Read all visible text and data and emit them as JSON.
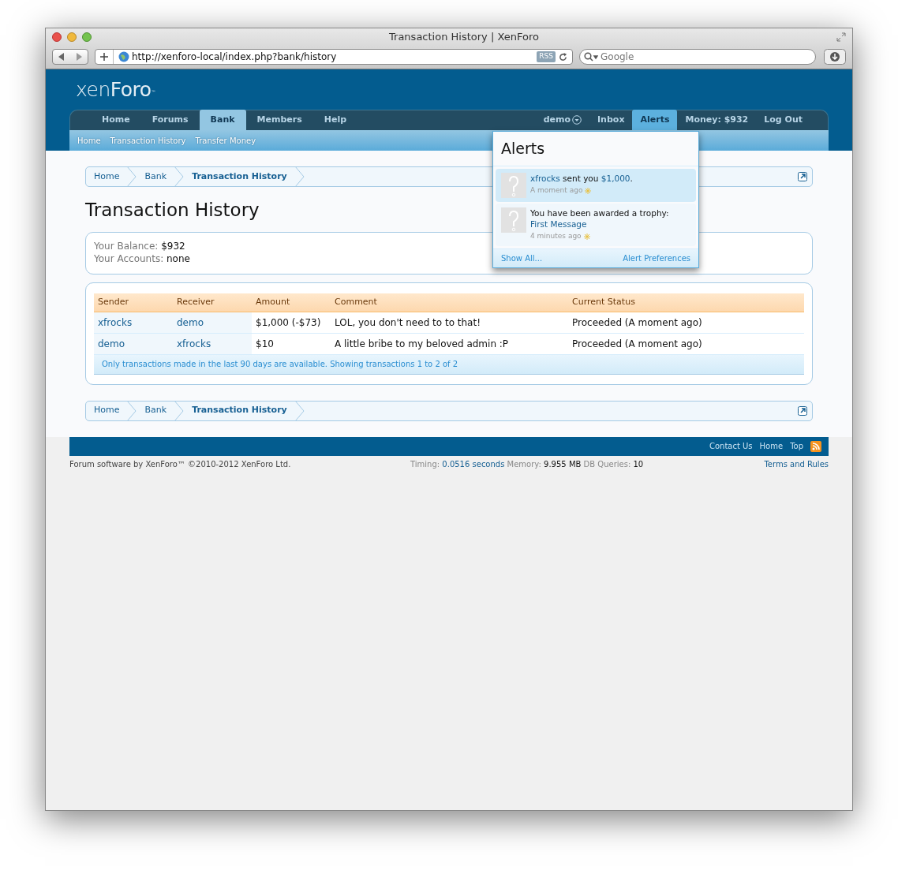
{
  "window": {
    "title": "Transaction History | XenForo"
  },
  "toolbar": {
    "url": "http://xenforo-local/index.php?bank/history",
    "rss": "RSS",
    "search_placeholder": "Google"
  },
  "logo": {
    "light": "xen",
    "bold": "Foro",
    "mark": "™"
  },
  "nav": {
    "tabs": [
      {
        "label": "Home",
        "selected": false
      },
      {
        "label": "Forums",
        "selected": false
      },
      {
        "label": "Bank",
        "selected": true
      },
      {
        "label": "Members",
        "selected": false
      },
      {
        "label": "Help",
        "selected": false
      }
    ],
    "user_links": [
      {
        "label": "demo",
        "kind": "menu",
        "selected": false
      },
      {
        "label": "Inbox",
        "kind": "link",
        "selected": false
      },
      {
        "label": "Alerts",
        "kind": "link",
        "selected": true
      },
      {
        "label": "Money: $932",
        "kind": "link",
        "selected": false
      },
      {
        "label": "Log Out",
        "kind": "link",
        "selected": false
      }
    ]
  },
  "subnav": [
    "Home",
    "Transaction History",
    "Transfer Money"
  ],
  "breadcrumbs_top": [
    "Home",
    "Bank",
    "Transaction History"
  ],
  "page_title": "Transaction History",
  "summary": [
    {
      "label": "Your Balance:",
      "value": "$932"
    },
    {
      "label": "Your Accounts:",
      "value": "none"
    }
  ],
  "table": {
    "columns": [
      "Sender",
      "Receiver",
      "Amount",
      "Comment",
      "Current Status"
    ],
    "rows": [
      {
        "sender": "xfrocks",
        "receiver": "demo",
        "amount": "$1,000 (-$73)",
        "comment": "LOL, you don't need to to that!",
        "status": "Proceeded (A moment ago)"
      },
      {
        "sender": "demo",
        "receiver": "xfrocks",
        "amount": "$10",
        "comment": "A little bribe to my beloved admin :P",
        "status": "Proceeded (A moment ago)"
      }
    ],
    "note": "Only transactions made in the last 90 days are available. Showing transactions 1 to 2 of 2"
  },
  "breadcrumbs_bottom": [
    "Home",
    "Bank",
    "Transaction History"
  ],
  "footer": {
    "links": [
      "Contact Us",
      "Home",
      "Top"
    ],
    "copyright": "Forum software by XenForo™ ©2010-2012 XenForo Ltd.",
    "debug": [
      {
        "label": "Timing:",
        "value": "0.0516 seconds",
        "kind": "link"
      },
      {
        "label": "Memory:",
        "value": "9.955 MB",
        "kind": "text"
      },
      {
        "label": "DB Queries:",
        "value": "10",
        "kind": "text"
      }
    ],
    "terms": "Terms and Rules"
  },
  "alerts_popup": {
    "title": "Alerts",
    "items": [
      {
        "unread": true,
        "parts": [
          {
            "text": "xfrocks",
            "kind": "link"
          },
          {
            "text": " sent you ",
            "kind": "text"
          },
          {
            "text": "$1,000",
            "kind": "link"
          },
          {
            "text": ".",
            "kind": "text"
          }
        ],
        "time": "A moment ago"
      },
      {
        "unread": false,
        "parts": [
          {
            "text": "You have been awarded a trophy: ",
            "kind": "text"
          },
          {
            "text": "First Message",
            "kind": "link"
          }
        ],
        "time": "4 minutes ago"
      }
    ],
    "show_all": "Show All...",
    "preferences": "Alert Preferences"
  }
}
